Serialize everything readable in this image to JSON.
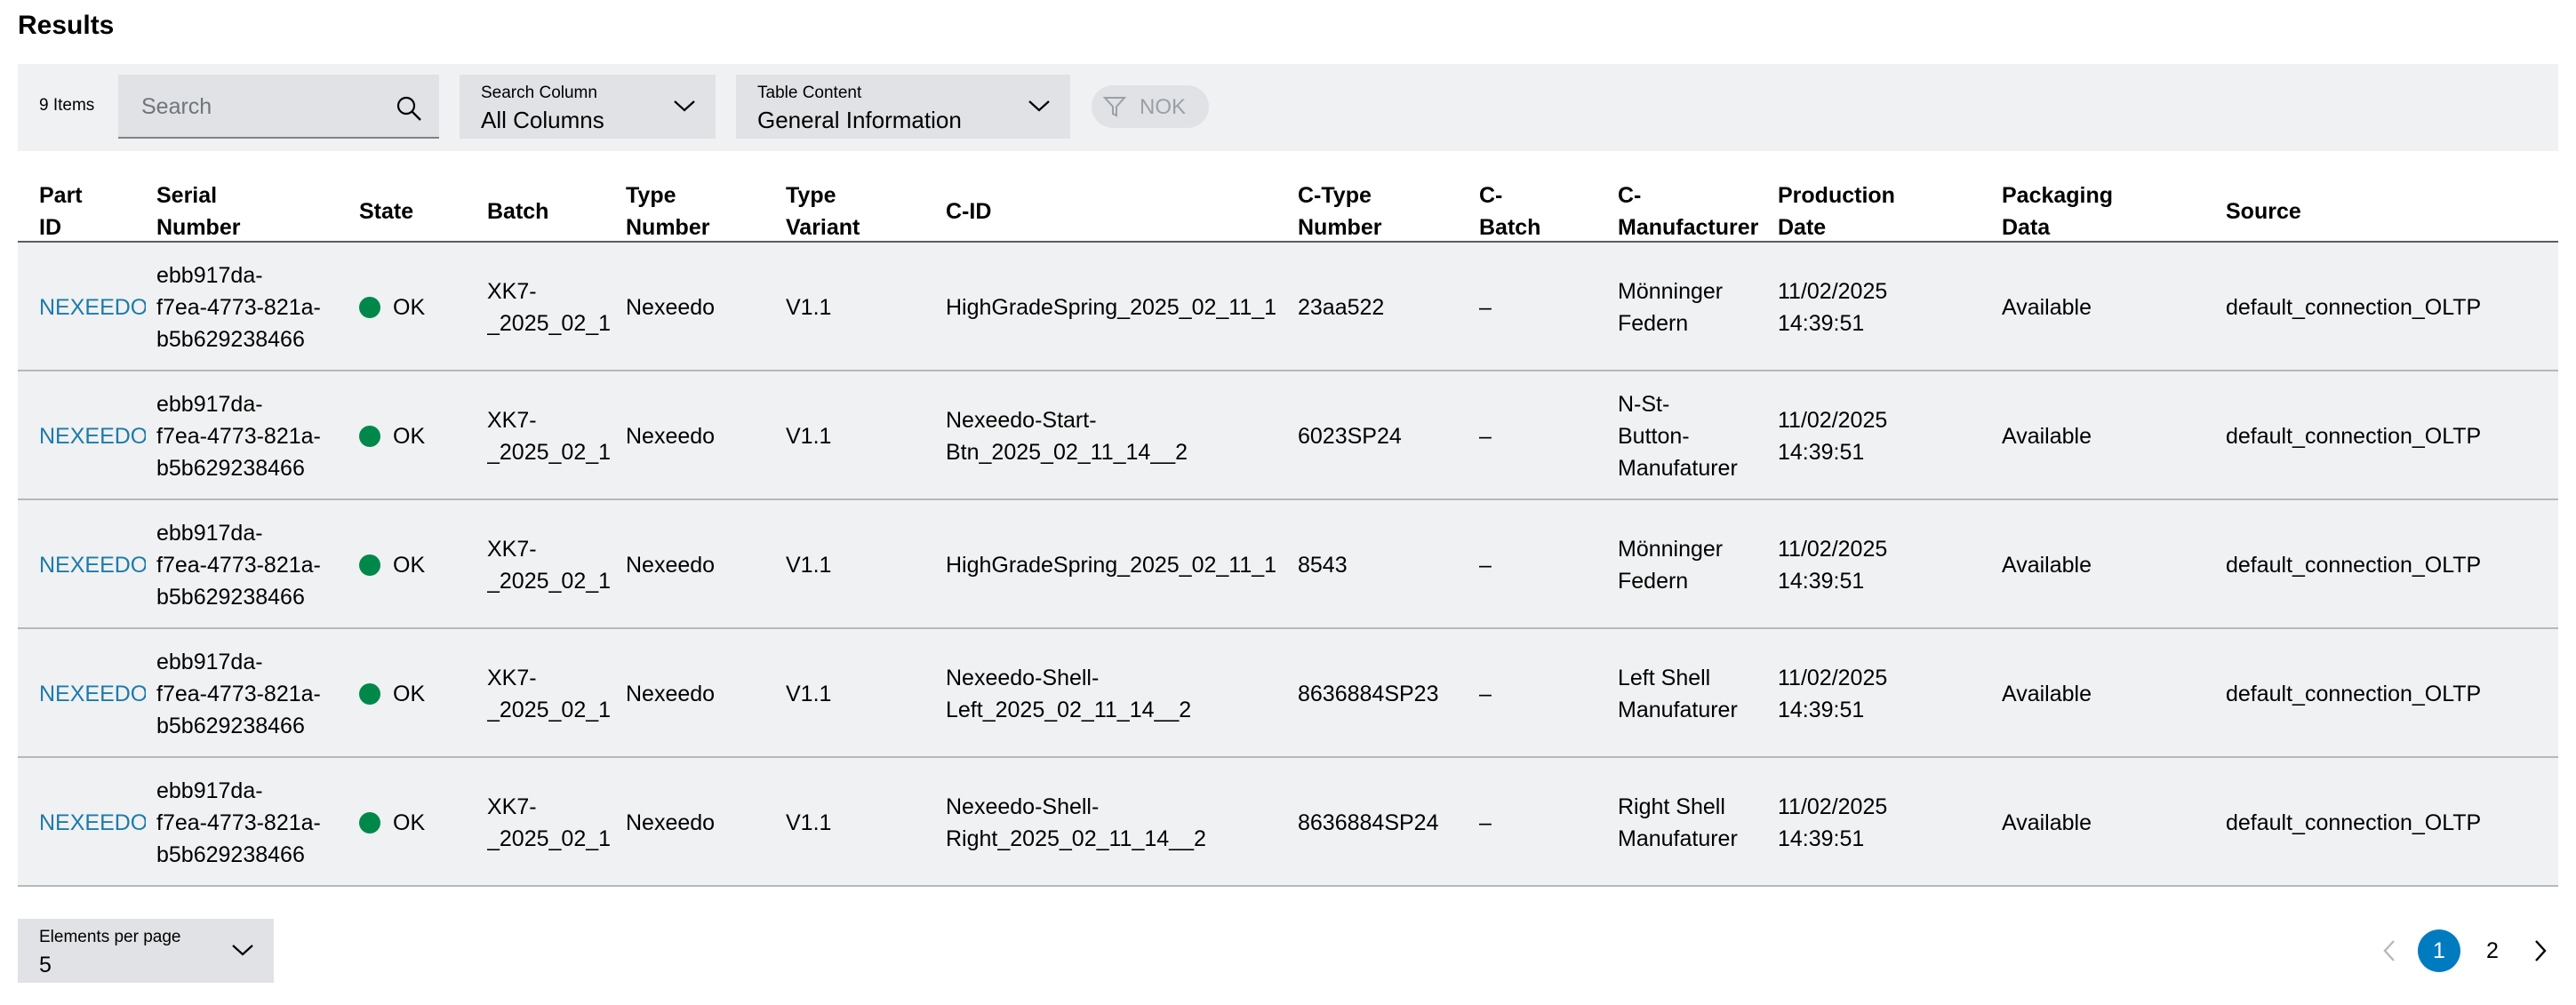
{
  "title": "Results",
  "toolbar": {
    "items_count": "9 Items",
    "search_placeholder": "Search",
    "search_column": {
      "label": "Search Column",
      "value": "All Columns"
    },
    "table_content": {
      "label": "Table Content",
      "value": "General Information"
    },
    "filter_label": "NOK"
  },
  "columns": [
    {
      "l1": "Part",
      "l2": "ID"
    },
    {
      "l1": "Serial",
      "l2": "Number"
    },
    {
      "l1": "State",
      "l2": ""
    },
    {
      "l1": "Batch",
      "l2": ""
    },
    {
      "l1": "Type",
      "l2": "Number"
    },
    {
      "l1": "Type",
      "l2": "Variant"
    },
    {
      "l1": "C-ID",
      "l2": ""
    },
    {
      "l1": "C-Type",
      "l2": "Number"
    },
    {
      "l1": "C-",
      "l2": "Batch"
    },
    {
      "l1": "C-",
      "l2": "Manufacturer"
    },
    {
      "l1": "Production",
      "l2": "Date"
    },
    {
      "l1": "Packaging",
      "l2": "Data"
    },
    {
      "l1": "Source",
      "l2": ""
    }
  ],
  "rows": [
    {
      "part_id": "NEXEEDO",
      "serial": [
        "ebb917da-",
        "f7ea-4773-821a-",
        "b5b629238466"
      ],
      "state": "OK",
      "batch": [
        "XK7-",
        "_2025_02_1"
      ],
      "type_number": "Nexeedo",
      "type_variant": "V1.1",
      "c_id": [
        "HighGradeSpring_2025_02_11_1"
      ],
      "c_type_number": "23aa522",
      "c_batch": "–",
      "c_manufacturer": [
        "Mönninger",
        "Federn"
      ],
      "production_date": [
        "11/02/2025",
        "14:39:51"
      ],
      "packaging": "Available",
      "source": "default_connection_OLTP"
    },
    {
      "part_id": "NEXEEDO",
      "serial": [
        "ebb917da-",
        "f7ea-4773-821a-",
        "b5b629238466"
      ],
      "state": "OK",
      "batch": [
        "XK7-",
        "_2025_02_1"
      ],
      "type_number": "Nexeedo",
      "type_variant": "V1.1",
      "c_id": [
        "Nexeedo-Start-",
        "Btn_2025_02_11_14__2"
      ],
      "c_type_number": "6023SP24",
      "c_batch": "–",
      "c_manufacturer": [
        "N-St-",
        "Button-",
        "Manufaturer"
      ],
      "production_date": [
        "11/02/2025",
        "14:39:51"
      ],
      "packaging": "Available",
      "source": "default_connection_OLTP"
    },
    {
      "part_id": "NEXEEDO",
      "serial": [
        "ebb917da-",
        "f7ea-4773-821a-",
        "b5b629238466"
      ],
      "state": "OK",
      "batch": [
        "XK7-",
        "_2025_02_1"
      ],
      "type_number": "Nexeedo",
      "type_variant": "V1.1",
      "c_id": [
        "HighGradeSpring_2025_02_11_1"
      ],
      "c_type_number": "8543",
      "c_batch": "–",
      "c_manufacturer": [
        "Mönninger",
        "Federn"
      ],
      "production_date": [
        "11/02/2025",
        "14:39:51"
      ],
      "packaging": "Available",
      "source": "default_connection_OLTP"
    },
    {
      "part_id": "NEXEEDO",
      "serial": [
        "ebb917da-",
        "f7ea-4773-821a-",
        "b5b629238466"
      ],
      "state": "OK",
      "batch": [
        "XK7-",
        "_2025_02_1"
      ],
      "type_number": "Nexeedo",
      "type_variant": "V1.1",
      "c_id": [
        "Nexeedo-Shell-",
        "Left_2025_02_11_14__2"
      ],
      "c_type_number": "8636884SP23",
      "c_batch": "–",
      "c_manufacturer": [
        "Left Shell",
        "Manufaturer"
      ],
      "production_date": [
        "11/02/2025",
        "14:39:51"
      ],
      "packaging": "Available",
      "source": "default_connection_OLTP"
    },
    {
      "part_id": "NEXEEDO",
      "serial": [
        "ebb917da-",
        "f7ea-4773-821a-",
        "b5b629238466"
      ],
      "state": "OK",
      "batch": [
        "XK7-",
        "_2025_02_1"
      ],
      "type_number": "Nexeedo",
      "type_variant": "V1.1",
      "c_id": [
        "Nexeedo-Shell-",
        "Right_2025_02_11_14__2"
      ],
      "c_type_number": "8636884SP24",
      "c_batch": "–",
      "c_manufacturer": [
        "Right Shell",
        "Manufaturer"
      ],
      "production_date": [
        "11/02/2025",
        "14:39:51"
      ],
      "packaging": "Available",
      "source": "default_connection_OLTP"
    }
  ],
  "pagination": {
    "per_page_label": "Elements per page",
    "per_page_value": "5",
    "pages": [
      "1",
      "2"
    ],
    "current_page": "1"
  },
  "colors": {
    "link": "#1d7aab",
    "ok_status": "#00884a",
    "accent": "#007bc0",
    "row_background": "#eff1f2"
  }
}
